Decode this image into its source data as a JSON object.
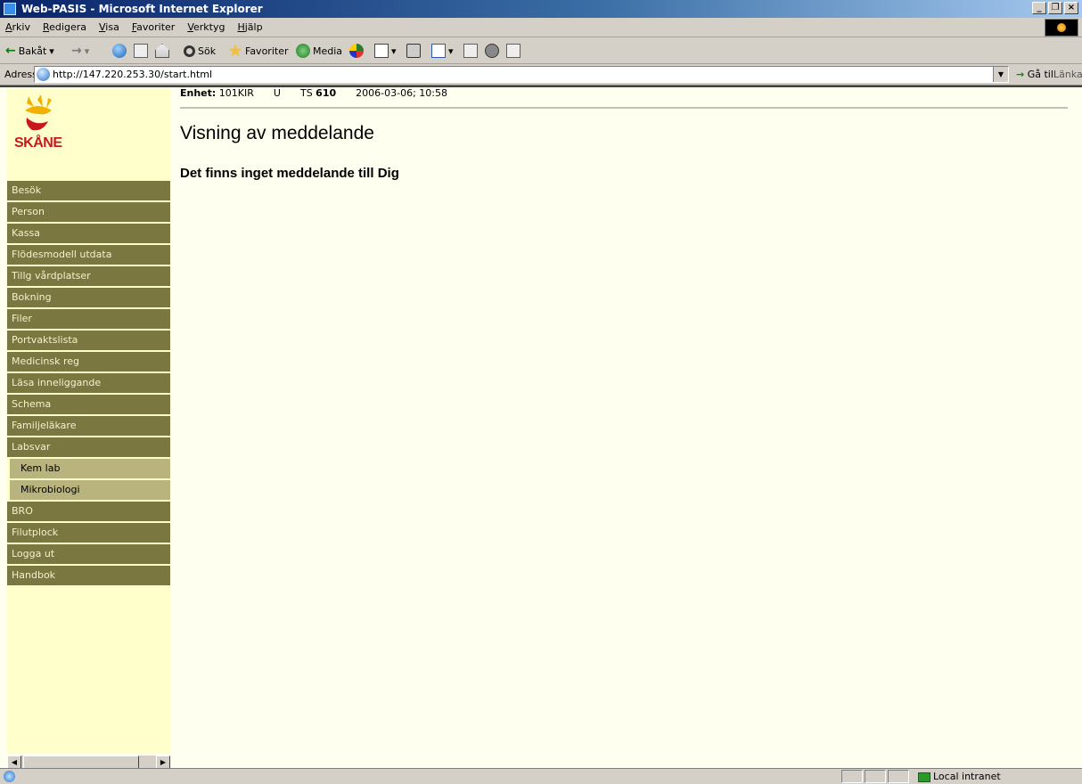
{
  "window": {
    "title": "Web-PASIS - Microsoft Internet Explorer",
    "controls": [
      "_",
      "❐",
      "×"
    ]
  },
  "menubar": {
    "items": [
      "Arkiv",
      "Redigera",
      "Visa",
      "Favoriter",
      "Verktyg",
      "Hjälp"
    ]
  },
  "toolbar": {
    "back": "Bakåt",
    "search": "Sök",
    "favorites": "Favoriter",
    "media": "Media"
  },
  "address": {
    "label": "Adress",
    "url": "http://147.220.253.30/start.html",
    "go": "Gå till",
    "links": "Länkar"
  },
  "sidebar": {
    "logo_text": "SKÅNE",
    "nav": [
      {
        "label": "Besök",
        "level": 0
      },
      {
        "label": "Person",
        "level": 0
      },
      {
        "label": "Kassa",
        "level": 0
      },
      {
        "label": "Flödesmodell utdata",
        "level": 0
      },
      {
        "label": "Tillg vårdplatser",
        "level": 0
      },
      {
        "label": "Bokning",
        "level": 0
      },
      {
        "label": "Filer",
        "level": 0
      },
      {
        "label": "Portvaktslista",
        "level": 0
      },
      {
        "label": "Medicinsk reg",
        "level": 0
      },
      {
        "label": "Läsa inneliggande",
        "level": 0
      },
      {
        "label": "Schema",
        "level": 0
      },
      {
        "label": "Familjeläkare",
        "level": 0
      },
      {
        "label": "Labsvar",
        "level": 0
      },
      {
        "label": "Kem lab",
        "level": 1
      },
      {
        "label": "Mikrobiologi",
        "level": 1
      },
      {
        "label": "BRO",
        "level": 0
      },
      {
        "label": "Filutplock",
        "level": 0
      },
      {
        "label": "Logga ut",
        "level": 0
      },
      {
        "label": "Handbok",
        "level": 0
      }
    ]
  },
  "main": {
    "unit_label": "Enhet:",
    "unit_value": "101KIR",
    "u_value": "U",
    "ts_label": "TS",
    "ts_value": "610",
    "datetime": "2006-03-06; 10:58",
    "title": "Visning av meddelande",
    "message": "Det finns inget meddelande till Dig"
  },
  "statusbar": {
    "zone": "Local intranet"
  },
  "colors": {
    "nav_bg": "#7a7740",
    "nav_sub_bg": "#b9b37e",
    "sidebar_bg": "#ffffcc",
    "content_bg": "#fffff0",
    "logo_red": "#c8181e"
  }
}
